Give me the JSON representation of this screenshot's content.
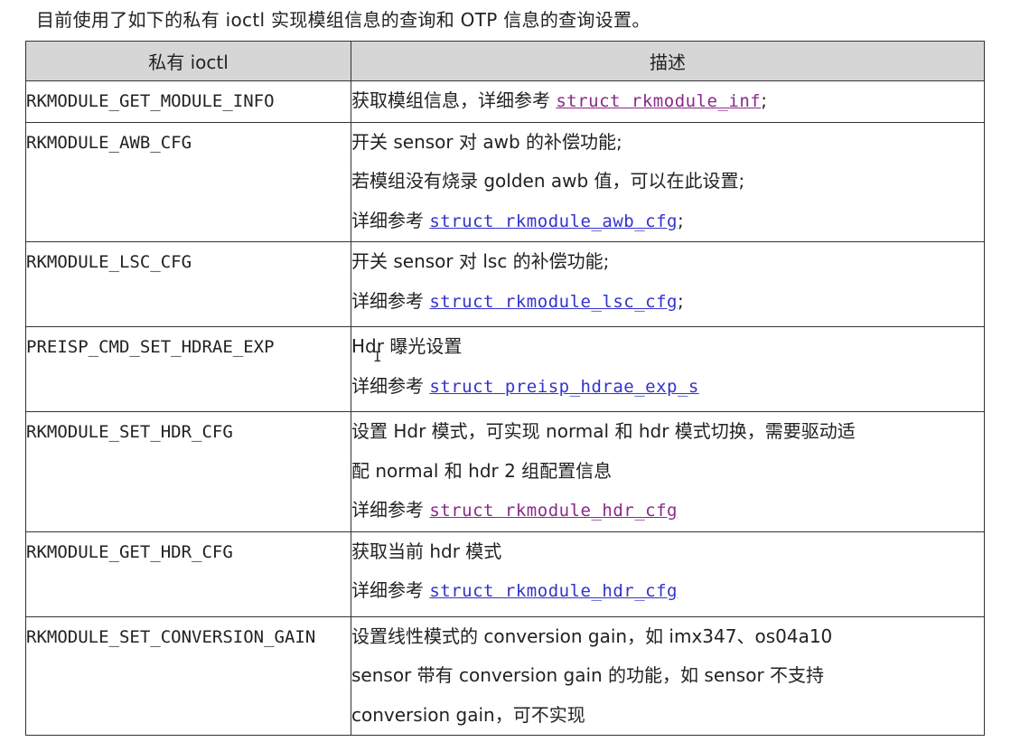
{
  "intro": "目前使用了如下的私有 ioctl 实现模组信息的查询和 OTP 信息的查询设置。",
  "table": {
    "headers": [
      "私有 ioctl",
      "描述"
    ],
    "rows": [
      {
        "name": "RKMODULE_GET_MODULE_INFO",
        "lines": [
          {
            "text": "获取模组信息，详细参考 ",
            "link": "struct rkmodule_inf",
            "link_color": "purple",
            "after": ";"
          }
        ]
      },
      {
        "name": "RKMODULE_AWB_CFG",
        "lines": [
          {
            "text": "开关 sensor 对 awb 的补偿功能;"
          },
          {
            "text": "若模组没有烧录 golden awb 值，可以在此设置;"
          },
          {
            "text": "详细参考 ",
            "link": "struct rkmodule_awb_cfg",
            "link_color": "blue",
            "after": ";"
          }
        ]
      },
      {
        "name": "RKMODULE_LSC_CFG",
        "lines": [
          {
            "text": "开关 sensor 对 lsc 的补偿功能;"
          },
          {
            "text": "详细参考 ",
            "link": "struct rkmodule_lsc_cfg",
            "link_color": "blue",
            "after": ";"
          }
        ]
      },
      {
        "name": "PREISP_CMD_SET_HDRAE_EXP",
        "lines": [
          {
            "text": "Hdr 曝光设置"
          },
          {
            "text": "详细参考 ",
            "link": "struct preisp_hdrae_exp_s",
            "link_color": "blue",
            "after": ""
          }
        ]
      },
      {
        "name": "RKMODULE_SET_HDR_CFG",
        "lines": [
          {
            "text": "设置 Hdr 模式，可实现 normal 和 hdr 模式切换，需要驱动适"
          },
          {
            "text": "配 normal 和 hdr 2 组配置信息"
          },
          {
            "text": "详细参考 ",
            "link": "struct rkmodule_hdr_cfg",
            "link_color": "purple",
            "after": ""
          }
        ]
      },
      {
        "name": "RKMODULE_GET_HDR_CFG",
        "lines": [
          {
            "text": "获取当前 hdr 模式"
          },
          {
            "text": "详细参考 ",
            "link": "struct rkmodule_hdr_cfg",
            "link_color": "blue",
            "after": ""
          }
        ]
      },
      {
        "name": "RKMODULE_SET_CONVERSION_GAIN",
        "lines": [
          {
            "text": "设置线性模式的 conversion gain，如 imx347、os04a10"
          },
          {
            "text": "sensor 带有 conversion gain 的功能，如 sensor 不支持"
          },
          {
            "text": "conversion gain，可不实现"
          }
        ]
      }
    ]
  }
}
